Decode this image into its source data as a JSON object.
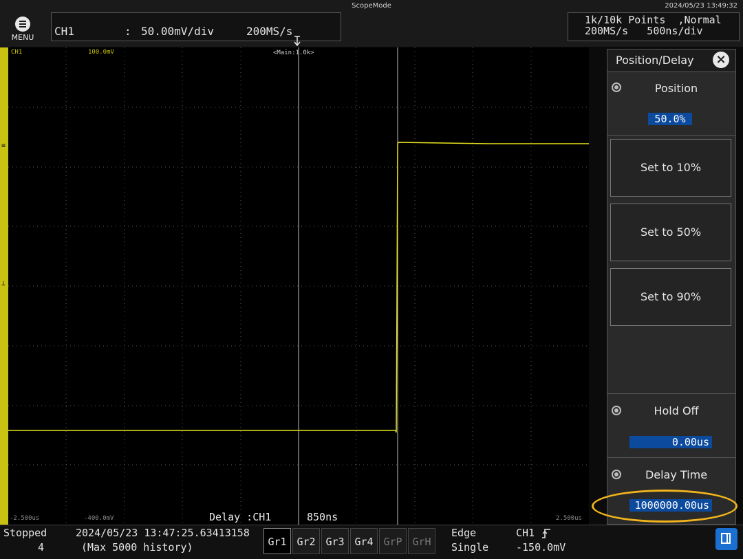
{
  "header": {
    "mode": "ScopeMode",
    "datetime": "2024/05/23 13:49:32",
    "menu_label": "MENU",
    "channel": "CH1",
    "colon": ":",
    "vdiv": "50.00mV/div",
    "sample_rate": "200MS/s",
    "points_line": "1k/10k Points  ,Normal",
    "rate_line": "200MS/s   500ns/div"
  },
  "waveform": {
    "channel_tag": "CH1",
    "scale_tag": "100.0mV",
    "zoom_tag": "<Main:1.0k>",
    "x_min": "-2.500us",
    "offset": "-400.0mV",
    "x_max": "2.500us",
    "delay_label": "Delay :CH1",
    "delay_value": "850ns",
    "trace_color": "#e8e21c"
  },
  "panel": {
    "title": "Position/Delay",
    "position_label": "Position",
    "position_value": "50.0%",
    "set10_label": "Set to 10%",
    "set50_label": "Set to 50%",
    "set90_label": "Set to 90%",
    "holdoff_label": "Hold Off",
    "holdoff_value": "0.00us",
    "delaytime_label": "Delay Time",
    "delaytime_value": "1000000.00us"
  },
  "status": {
    "state": "Stopped",
    "count": "4",
    "acq_time": "2024/05/23 13:47:25.63413158",
    "history": "(Max 5000 history)",
    "groups": [
      "Gr1",
      "Gr2",
      "Gr3",
      "Gr4",
      "GrP",
      "GrH"
    ],
    "trigger_type": "Edge",
    "trigger_mode": "Single",
    "trigger_source": "CH1",
    "trigger_level": "-150.0mV"
  },
  "colors": {
    "channel_yellow": "#c9c213",
    "value_blue": "#0c4a9e",
    "highlight_orange": "#f1b41c"
  }
}
